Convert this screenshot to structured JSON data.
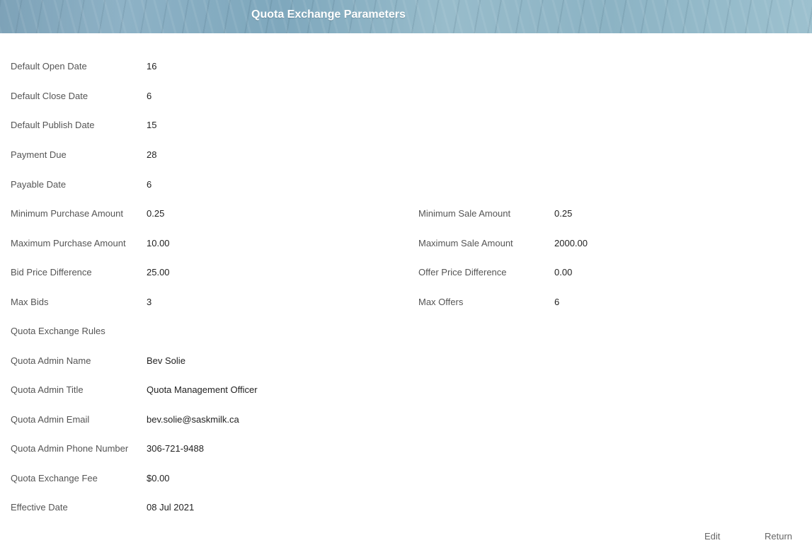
{
  "header": {
    "title": "Quota Exchange Parameters"
  },
  "fields": {
    "default_open_date": {
      "label": "Default Open Date",
      "value": "16"
    },
    "default_close_date": {
      "label": "Default Close Date",
      "value": "6"
    },
    "default_publish_date": {
      "label": "Default Publish Date",
      "value": "15"
    },
    "payment_due": {
      "label": "Payment Due",
      "value": "28"
    },
    "payable_date": {
      "label": "Payable Date",
      "value": "6"
    },
    "minimum_purchase_amount": {
      "label": "Minimum Purchase Amount",
      "value": "0.25"
    },
    "minimum_sale_amount": {
      "label": "Minimum Sale Amount",
      "value": "0.25"
    },
    "maximum_purchase_amount": {
      "label": "Maximum Purchase Amount",
      "value": "10.00"
    },
    "maximum_sale_amount": {
      "label": "Maximum Sale Amount",
      "value": "2000.00"
    },
    "bid_price_difference": {
      "label": "Bid Price Difference",
      "value": "25.00"
    },
    "offer_price_difference": {
      "label": "Offer Price Difference",
      "value": "0.00"
    },
    "max_bids": {
      "label": "Max Bids",
      "value": "3"
    },
    "max_offers": {
      "label": "Max Offers",
      "value": "6"
    },
    "quota_exchange_rules": {
      "label": "Quota Exchange Rules",
      "value": ""
    },
    "quota_admin_name": {
      "label": "Quota Admin Name",
      "value": "Bev Solie"
    },
    "quota_admin_title": {
      "label": "Quota Admin Title",
      "value": "Quota Management Officer"
    },
    "quota_admin_email": {
      "label": "Quota Admin Email",
      "value": "bev.solie@saskmilk.ca"
    },
    "quota_admin_phone": {
      "label": "Quota Admin Phone Number",
      "value": "306-721-9488"
    },
    "quota_exchange_fee": {
      "label": "Quota Exchange Fee",
      "value": "$0.00"
    },
    "effective_date": {
      "label": "Effective Date",
      "value": "08 Jul 2021"
    }
  },
  "actions": {
    "edit_label": "Edit",
    "return_label": "Return"
  }
}
